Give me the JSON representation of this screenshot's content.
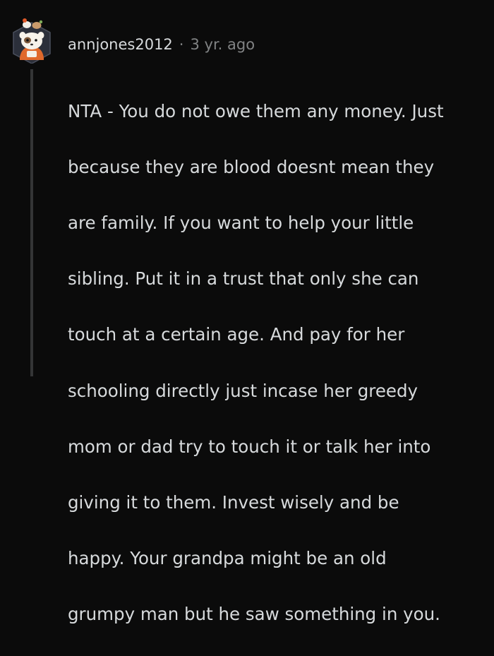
{
  "comment": {
    "username": "annjones2012",
    "separator": "·",
    "timestamp": "3 yr. ago",
    "avatar_icon": "snoo-avatar-icon",
    "body_lines": [
      "NTA - You do not owe them any money. Just",
      "because they are blood doesnt mean they",
      "are family. If you want to help your little",
      "sibling. Put it in a trust that only she can",
      "touch at a certain age. And pay for her",
      "schooling directly just incase her greedy",
      "mom or dad try to touch it or talk her into",
      "giving it to them. Invest wisely and be",
      "happy. Your grandpa might be an old",
      "grumpy man but he saw something in you."
    ]
  },
  "colors": {
    "background": "#0b0b0b",
    "text": "#d7dadc",
    "meta": "#818384",
    "thread_line": "#343536"
  }
}
